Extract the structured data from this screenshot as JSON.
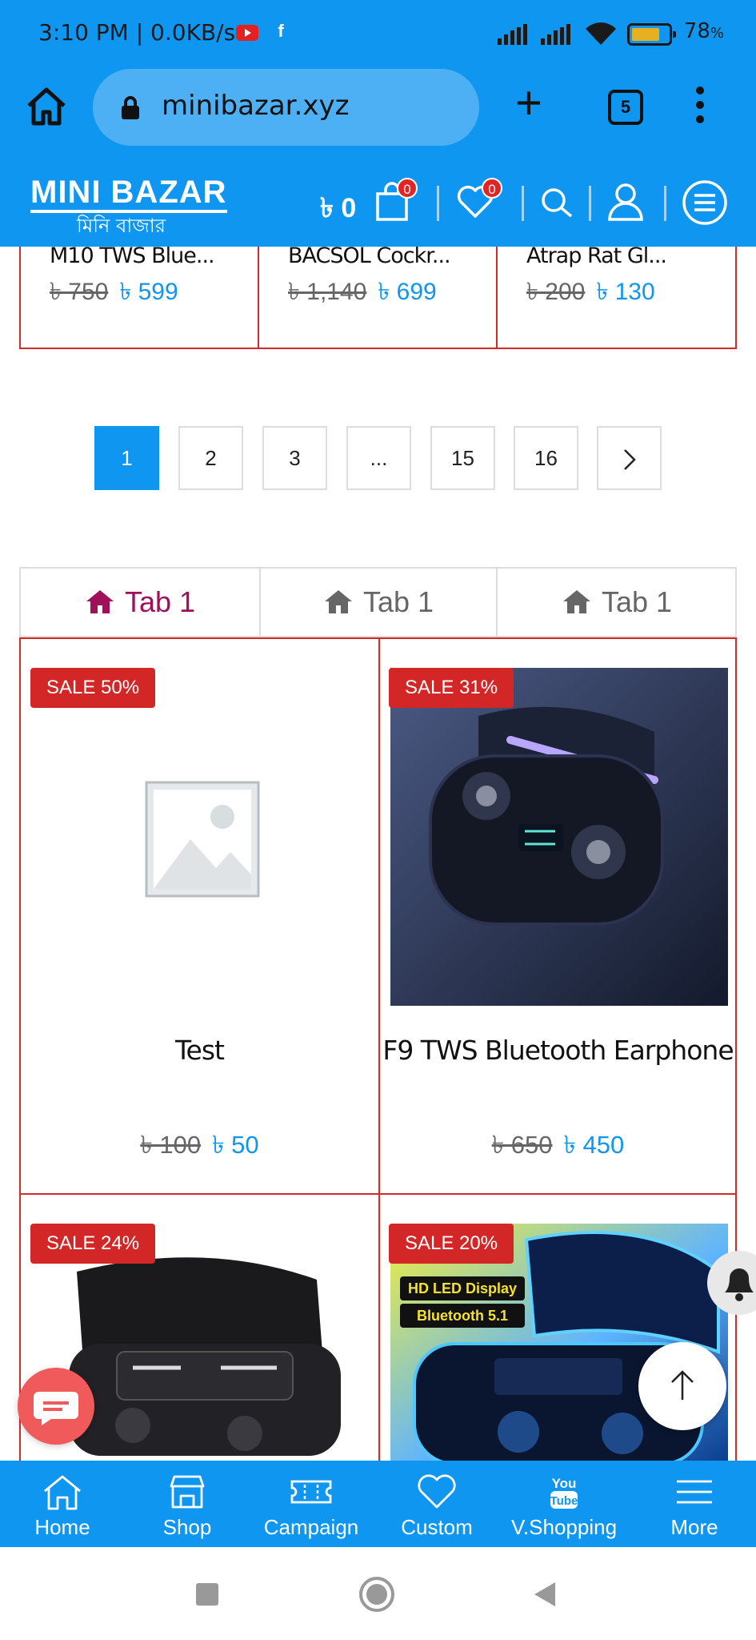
{
  "status_bar": {
    "time": "3:10 PM | 0.0KB/s",
    "fb_glyph": "f",
    "battery_percent": "78",
    "battery_suffix": "%",
    "battery_level": 0.78
  },
  "browser": {
    "url": "minibazar.xyz",
    "tab_count": "5"
  },
  "site_header": {
    "logo_en": "MINI BAZAR",
    "logo_bn": "মিনি বাজার",
    "cart_total": "৳ 0",
    "cart_badge": "0",
    "wishlist_badge": "0"
  },
  "top_products": [
    {
      "name": "M10 TWS Blue...",
      "old_price": "৳ 750",
      "new_price": "৳ 599"
    },
    {
      "name": "BACSOL Cockr...",
      "old_price": "৳ 1,140",
      "new_price": "৳ 699"
    },
    {
      "name": "Atrap Rat Gl...",
      "old_price": "৳ 200",
      "new_price": "৳ 130"
    }
  ],
  "pagination": [
    "1",
    "2",
    "3",
    "...",
    "15",
    "16"
  ],
  "tabs": [
    "Tab 1",
    "Tab 1",
    "Tab 1"
  ],
  "products": [
    {
      "sale": "SALE 50%",
      "name": "Test",
      "old_price": "৳ 100",
      "new_price": "৳ 50"
    },
    {
      "sale": "SALE 31%",
      "name": "F9 TWS Bluetooth Earphone",
      "old_price": "৳ 650",
      "new_price": "৳ 450"
    },
    {
      "sale": "SALE 24%"
    },
    {
      "sale": "SALE 20%",
      "overlay_line1": "HD LED Display",
      "overlay_line2": "Bluetooth 5.1"
    }
  ],
  "bottom_nav": [
    {
      "label": "Home",
      "icon": "home-icon"
    },
    {
      "label": "Shop",
      "icon": "shop-icon"
    },
    {
      "label": "Campaign",
      "icon": "ticket-icon"
    },
    {
      "label": "Custom",
      "icon": "heart-icon"
    },
    {
      "label": "V.Shopping",
      "icon": "youtube-icon"
    },
    {
      "label": "More",
      "icon": "menu-icon"
    }
  ],
  "colors": {
    "primary": "#0f96f0",
    "sale": "#d32626",
    "active_tab": "#a0105a",
    "border": "#d62a2a"
  }
}
